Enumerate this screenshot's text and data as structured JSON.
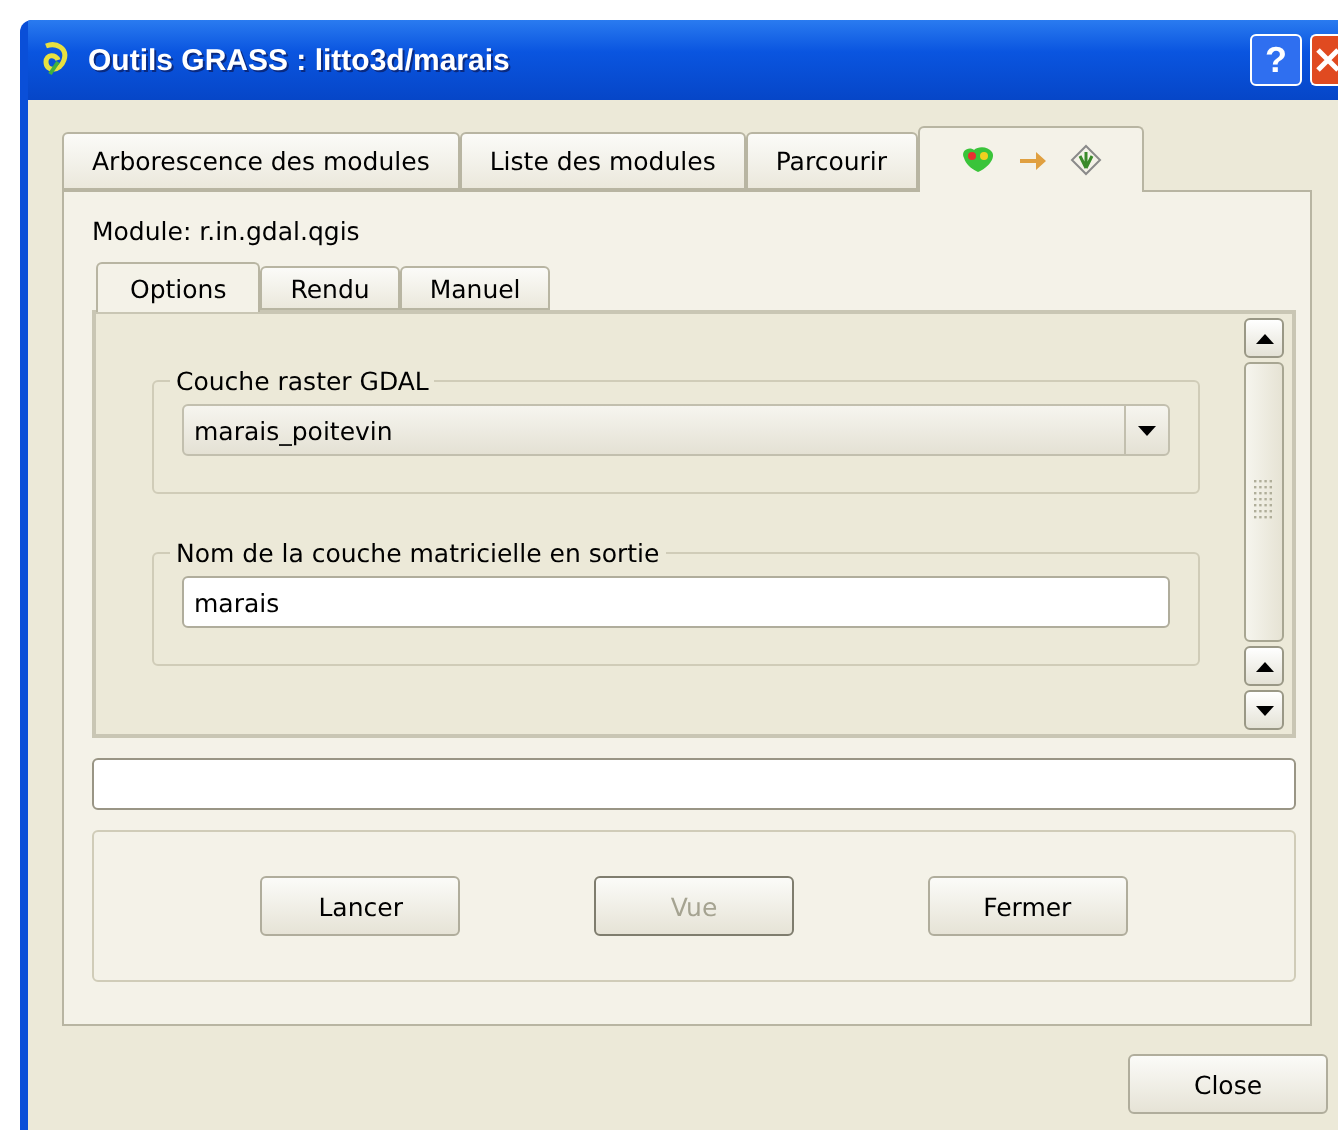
{
  "window": {
    "title": "Outils GRASS : litto3d/marais",
    "help_button": "?"
  },
  "main_tabs": [
    {
      "kind": "text",
      "label": "Arborescence des modules",
      "selected": false
    },
    {
      "kind": "text",
      "label": "Liste des modules",
      "selected": false
    },
    {
      "kind": "text",
      "label": "Parcourir",
      "selected": false
    },
    {
      "kind": "icons",
      "selected": true
    }
  ],
  "module_label": "Module: r.in.gdal.qgis",
  "inner_tabs": [
    {
      "label": "Options",
      "selected": true
    },
    {
      "label": "Rendu",
      "selected": false
    },
    {
      "label": "Manuel",
      "selected": false
    }
  ],
  "groups": [
    {
      "kind": "combo",
      "title": "Couche raster GDAL",
      "value": "marais_poitevin"
    },
    {
      "kind": "text",
      "title": "Nom de la couche matricielle en sortie",
      "value": "marais"
    }
  ],
  "action_buttons": [
    {
      "label": "Lancer",
      "disabled": false
    },
    {
      "label": "Vue",
      "disabled": true
    },
    {
      "label": "Fermer",
      "disabled": false
    }
  ],
  "close_button": "Close"
}
